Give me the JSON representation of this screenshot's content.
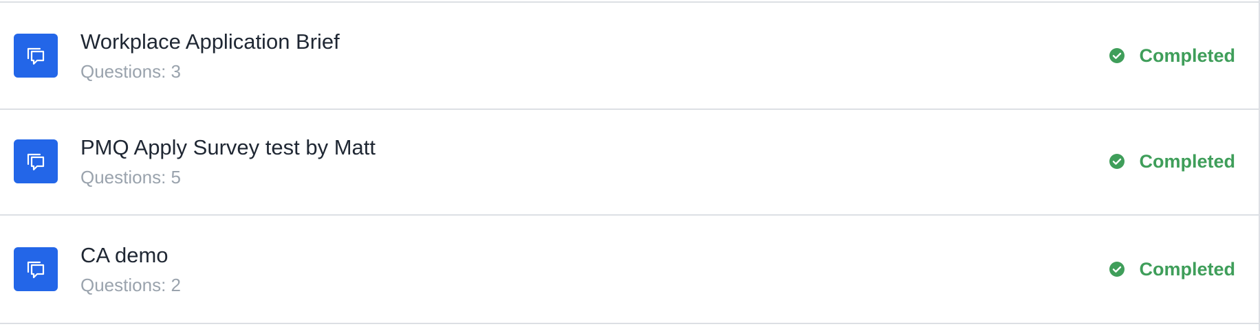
{
  "colors": {
    "icon_tile": "#2366e8",
    "status_completed": "#3f9e5a",
    "title": "#1f2733",
    "subtitle": "#9aa3ad",
    "divider": "#dcdfe4"
  },
  "surveys": [
    {
      "icon": "chat-bubbles-icon",
      "title": "Workplace Application Brief",
      "questions_text": "Questions: 3",
      "status": {
        "icon": "check-circle-icon",
        "label": "Completed"
      }
    },
    {
      "icon": "chat-bubbles-icon",
      "title": "PMQ Apply Survey test by Matt",
      "questions_text": "Questions: 5",
      "status": {
        "icon": "check-circle-icon",
        "label": "Completed"
      }
    },
    {
      "icon": "chat-bubbles-icon",
      "title": "CA demo",
      "questions_text": "Questions: 2",
      "status": {
        "icon": "check-circle-icon",
        "label": "Completed"
      }
    }
  ]
}
